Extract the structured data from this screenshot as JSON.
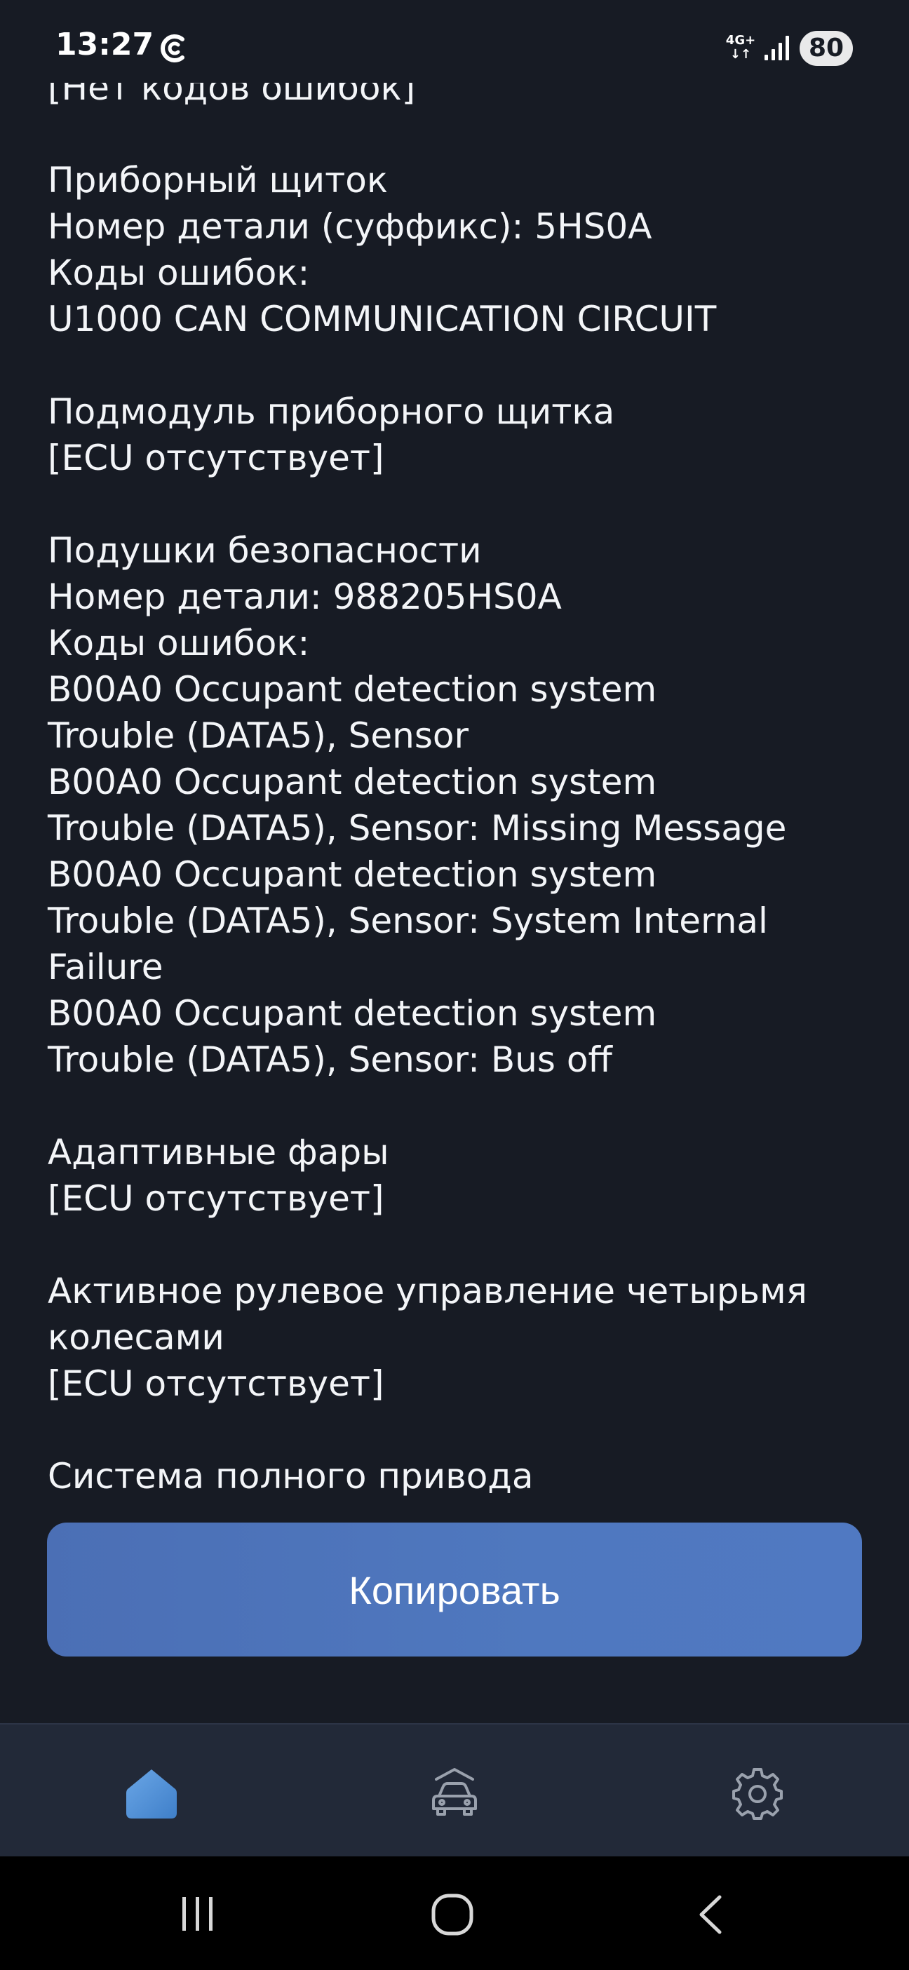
{
  "status_bar": {
    "time": "13:27",
    "network": "4G+",
    "battery": "80",
    "app_icon": "sync-c-icon",
    "signal_icon": "signal-bars-icon"
  },
  "report": {
    "lines": [
      "[Нет кодов ошибок]",
      "",
      "Приборный щиток",
      "Номер детали (суффикс): 5HS0A",
      "Коды ошибок:",
      "U1000 CAN COMMUNICATION CIRCUIT",
      "",
      "Подмодуль приборного щитка",
      "[ECU отсутствует]",
      "",
      "Подушки безопасности",
      "Номер детали: 988205HS0A",
      "Коды ошибок:",
      "B00A0 Occupant detection system",
      "Trouble (DATA5), Sensor",
      "B00A0 Occupant detection system",
      "Trouble (DATA5), Sensor: Missing Message",
      "B00A0 Occupant detection system",
      "Trouble (DATA5), Sensor: System Internal",
      "Failure",
      "B00A0 Occupant detection system",
      "Trouble (DATA5), Sensor: Bus off",
      "",
      "Адаптивные фары",
      "[ECU отсутствует]",
      "",
      "Активное рулевое управление четырьмя",
      "колесами",
      "[ECU отсутствует]",
      "",
      "Система полного привода"
    ]
  },
  "copy_button": {
    "label": "Копировать"
  },
  "tab_bar": {
    "tabs": [
      {
        "icon": "home-icon",
        "active": true
      },
      {
        "icon": "car-icon",
        "active": false
      },
      {
        "icon": "gear-icon",
        "active": false
      }
    ]
  },
  "nav_bar": {
    "buttons": [
      "recent-apps-icon",
      "home-circle-icon",
      "back-icon"
    ]
  },
  "colors": {
    "background": "#171b24",
    "text": "#f3f5f8",
    "button": "#4e76bd",
    "tab_bar": "#222938",
    "active_tab": "#4f8fd6",
    "inactive_tab": "#9aa1ad"
  }
}
